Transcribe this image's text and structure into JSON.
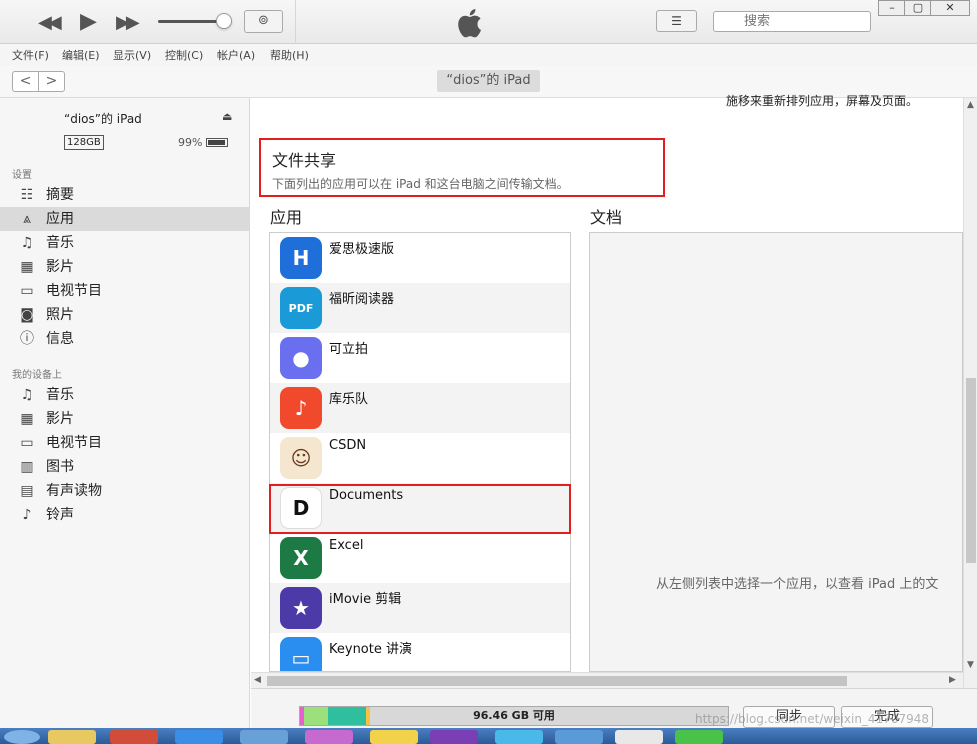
{
  "toolbar": {
    "search_placeholder": "搜索",
    "icons": [
      "rewind-icon",
      "play-icon",
      "fast-forward-icon",
      "airplay-icon",
      "apple-logo-icon",
      "list-view-icon",
      "search-icon"
    ],
    "window_controls": [
      "minimize",
      "maximize",
      "close"
    ]
  },
  "menu": [
    "文件(F)",
    "编辑(E)",
    "显示(V)",
    "控制(C)",
    "帐户(A)",
    "帮助(H)"
  ],
  "nav": {
    "back": "<",
    "forward": ">",
    "device_pill": "“dios”的 iPad"
  },
  "sidebar": {
    "device_name": "“dios”的 iPad",
    "capacity": "128GB",
    "battery": "99%",
    "settings_label": "设置",
    "settings_items": [
      {
        "label": "摘要",
        "icon": "summary-icon"
      },
      {
        "label": "应用",
        "icon": "apps-icon",
        "active": true
      },
      {
        "label": "音乐",
        "icon": "music-icon"
      },
      {
        "label": "影片",
        "icon": "film-icon"
      },
      {
        "label": "电视节目",
        "icon": "tv-icon"
      },
      {
        "label": "照片",
        "icon": "camera-icon"
      },
      {
        "label": "信息",
        "icon": "info-icon"
      }
    ],
    "device_label": "我的设备上",
    "device_items": [
      {
        "label": "音乐",
        "icon": "music-icon"
      },
      {
        "label": "影片",
        "icon": "film-icon"
      },
      {
        "label": "电视节目",
        "icon": "tv-icon"
      },
      {
        "label": "图书",
        "icon": "book-icon"
      },
      {
        "label": "有声读物",
        "icon": "audiobook-icon"
      },
      {
        "label": "铃声",
        "icon": "bell-icon"
      }
    ]
  },
  "main": {
    "top_cut_text": "施移来重新排列应用，屏幕及页面。",
    "file_sharing_title": "文件共享",
    "file_sharing_desc": "下面列出的应用可以在 iPad 和这台电脑之间传输文档。",
    "apps_header": "应用",
    "docs_header": "文档",
    "apps": [
      {
        "name": "爱思极速版",
        "icon_color": "#1e6fd9",
        "glyph": "H"
      },
      {
        "name": "福昕阅读器",
        "icon_color": "#1a9ad6",
        "glyph": "PDF"
      },
      {
        "name": "可立拍",
        "icon_color": "#6a6ff0",
        "glyph": "●"
      },
      {
        "name": "库乐队",
        "icon_color": "#f0492c",
        "glyph": "♪"
      },
      {
        "name": "CSDN",
        "icon_color": "#f5e6d0",
        "glyph": "☺"
      },
      {
        "name": "Documents",
        "icon_color": "#ffffff",
        "glyph": "D"
      },
      {
        "name": "Excel",
        "icon_color": "#1e7a45",
        "glyph": "X"
      },
      {
        "name": "iMovie 剪辑",
        "icon_color": "#4b3aa8",
        "glyph": "★"
      },
      {
        "name": "Keynote 讲演",
        "icon_color": "#2a8ef0",
        "glyph": "▭"
      }
    ],
    "docs_hint": "从左侧列表中选择一个应用，以查看 iPad 上的文"
  },
  "bottom": {
    "storage_free": "96.46 GB 可用",
    "sync_label": "同步",
    "done_label": "完成",
    "storage_colors": [
      "#e85fd0",
      "#9be07a",
      "#2fbf9e",
      "#f5c244",
      "#d8d8d8"
    ],
    "watermark": "https://blog.csdn.net/weixin_41707948"
  }
}
